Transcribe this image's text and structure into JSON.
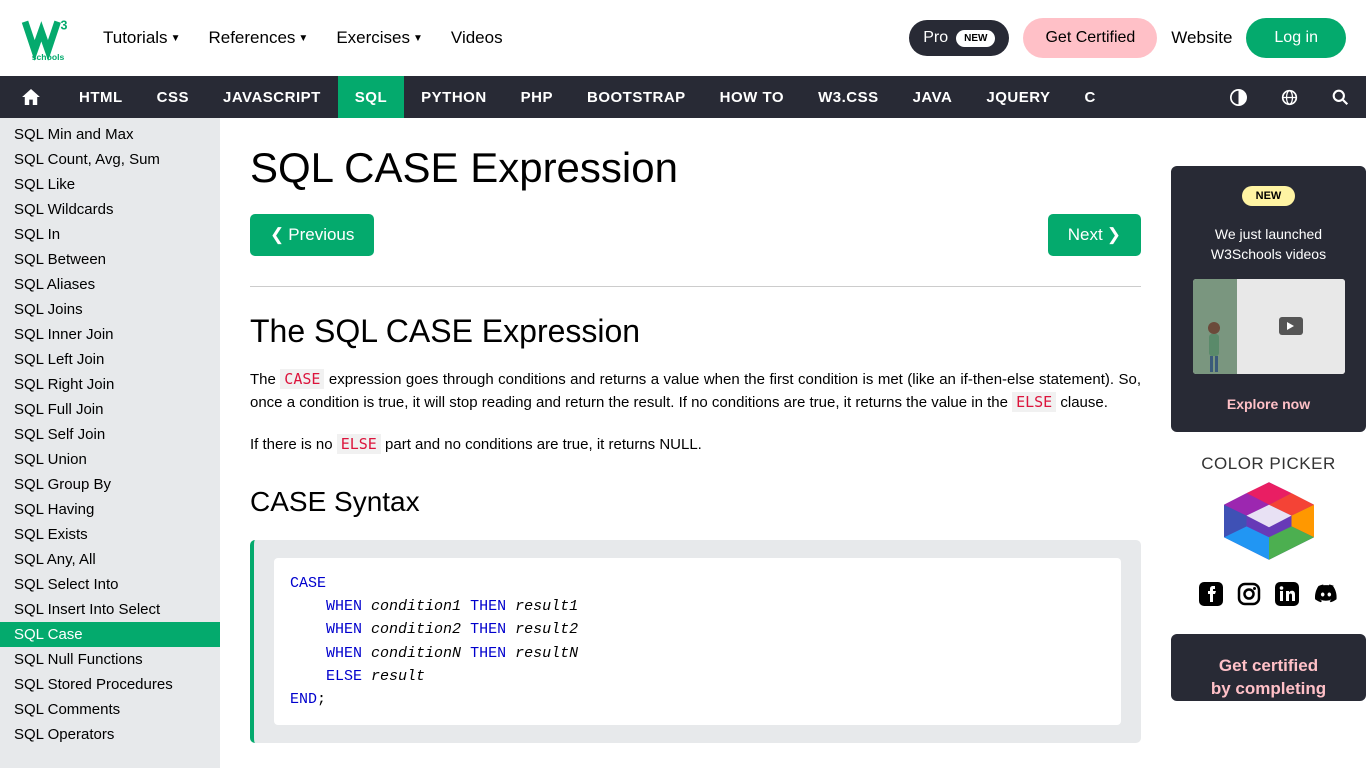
{
  "header": {
    "menu": [
      "Tutorials",
      "References",
      "Exercises",
      "Videos"
    ],
    "dropdown_indices": [
      0,
      1,
      2
    ],
    "pro_label": "Pro",
    "pro_badge": "NEW",
    "certified_label": "Get Certified",
    "website_label": "Website",
    "login_label": "Log in"
  },
  "topnav": {
    "items": [
      "HTML",
      "CSS",
      "JAVASCRIPT",
      "SQL",
      "PYTHON",
      "PHP",
      "BOOTSTRAP",
      "HOW TO",
      "W3.CSS",
      "JAVA",
      "JQUERY",
      "C"
    ],
    "active_index": 3
  },
  "sidebar": {
    "items": [
      "SQL Min and Max",
      "SQL Count, Avg, Sum",
      "SQL Like",
      "SQL Wildcards",
      "SQL In",
      "SQL Between",
      "SQL Aliases",
      "SQL Joins",
      "SQL Inner Join",
      "SQL Left Join",
      "SQL Right Join",
      "SQL Full Join",
      "SQL Self Join",
      "SQL Union",
      "SQL Group By",
      "SQL Having",
      "SQL Exists",
      "SQL Any, All",
      "SQL Select Into",
      "SQL Insert Into Select",
      "SQL Case",
      "SQL Null Functions",
      "SQL Stored Procedures",
      "SQL Comments",
      "SQL Operators"
    ],
    "active_index": 20
  },
  "content": {
    "title": "SQL CASE Expression",
    "prev_label": "Previous",
    "next_label": "Next",
    "heading1": "The SQL CASE Expression",
    "para1_a": "The ",
    "para1_code1": "CASE",
    "para1_b": " expression goes through conditions and returns a value when the first condition is met (like an if-then-else statement). So, once a condition is true, it will stop reading and return the result. If no conditions are true, it returns the value in the ",
    "para1_code2": "ELSE",
    "para1_c": " clause.",
    "para2_a": "If there is no ",
    "para2_code1": "ELSE",
    "para2_b": " part and no conditions are true, it returns NULL.",
    "syntax_heading": "CASE Syntax",
    "code": {
      "case": "CASE",
      "when": "WHEN",
      "then": "THEN",
      "else": "ELSE",
      "end": "END",
      "semi": ";",
      "cond1": "condition1",
      "res1": "result1",
      "cond2": "condition2",
      "res2": "result2",
      "condn": "conditionN",
      "resn": "resultN",
      "result": "result"
    }
  },
  "rightbar": {
    "new_badge": "NEW",
    "video_text": "We just launched W3Schools videos",
    "explore_label": "Explore now",
    "picker_title": "COLOR PICKER",
    "cert_text1": "Get certified",
    "cert_text2": "by completing"
  }
}
